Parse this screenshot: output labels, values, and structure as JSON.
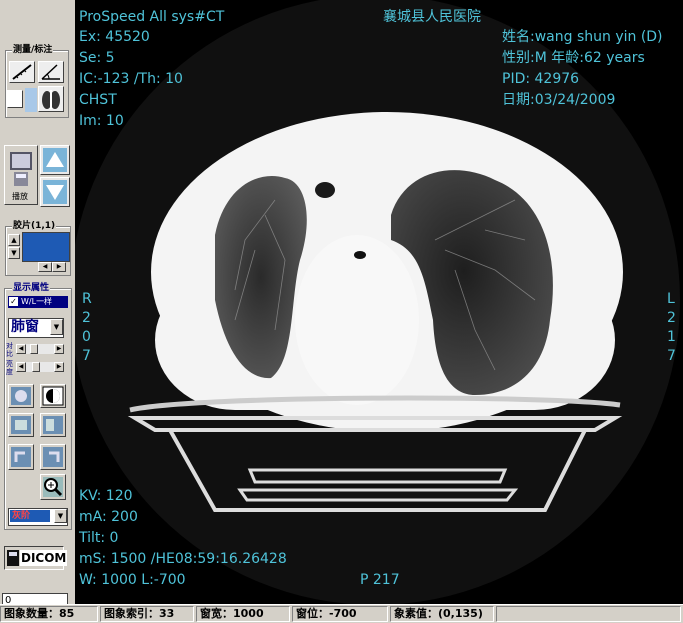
{
  "toolbar": {
    "measure_group": "测量/标注",
    "play_label": "播放",
    "film_group": "胶片(1,1)",
    "display_group": "显示属性",
    "same_checkbox": "W/L一样",
    "window_select": "肺窗",
    "contrast_label": "对比",
    "brightness_label": "亮度",
    "colormap_select": "灰阶",
    "dicom_button": "DICOM",
    "index_input": "0"
  },
  "overlay": {
    "line1": "ProSpeed All  sys#CT",
    "line2": "Ex: 45520",
    "line3": "Se: 5",
    "line4": "IC:-123 /Th: 10",
    "line5": "CHST",
    "line6": "Im: 10",
    "hospital": "襄城县人民医院",
    "patient_name": "姓名:wang shun yin (D)",
    "patient_sex_age": "性别:M  年龄:62 years",
    "pid": "PID: 42976",
    "date": "日期:03/24/2009",
    "left_orient": [
      "R",
      "2",
      "0",
      "7"
    ],
    "right_orient": [
      "L",
      "2",
      "1",
      "7"
    ],
    "kv": "KV: 120",
    "ma": "mA: 200",
    "tilt": "Tilt: 0",
    "ms": "mS: 1500  /HE08:59:16.26428",
    "wl": "W: 1000 L:-700",
    "pos": "P 217"
  },
  "status": {
    "count": "图象数量：85",
    "index": "图象索引：33",
    "width": "窗宽：1000",
    "level": "窗位：-700",
    "pixel": "象素值：(0,135)"
  },
  "colors": {
    "overlay_text": "#4fc3d9",
    "panel": "#d4d0c8"
  }
}
